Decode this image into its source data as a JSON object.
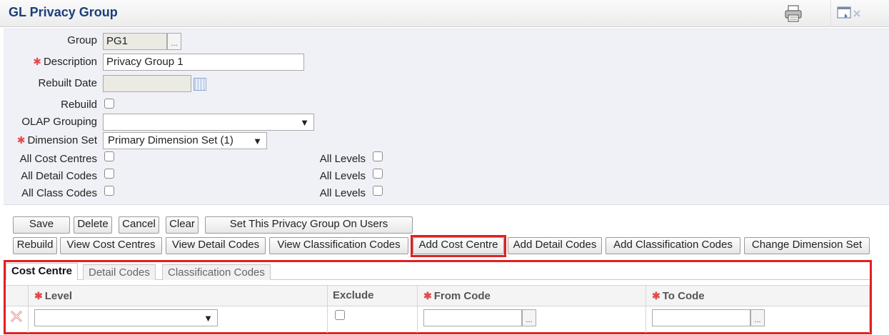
{
  "window": {
    "title": "GL Privacy Group"
  },
  "form": {
    "group_label": "Group",
    "group_value": "PG1",
    "lookup_glyph": "...",
    "description_label": "Description",
    "description_value": "Privacy Group 1",
    "rebuilt_date_label": "Rebuilt Date",
    "rebuild_label": "Rebuild",
    "olap_grouping_label": "OLAP Grouping",
    "dimension_set_label": "Dimension Set",
    "dimension_set_value": "Primary Dimension Set (1)",
    "all_cost_centres_label": "All Cost Centres",
    "all_detail_codes_label": "All Detail Codes",
    "all_class_codes_label": "All Class Codes",
    "all_levels_label": "All Levels",
    "required_marker": "✱"
  },
  "toolbar": {
    "save": "Save",
    "delete": "Delete",
    "cancel": "Cancel",
    "clear": "Clear",
    "set_on_users": "Set This Privacy Group On Users",
    "rebuild": "Rebuild",
    "view_cost_centres": "View Cost Centres",
    "view_detail_codes": "View Detail Codes",
    "view_classification_codes": "View Classification Codes",
    "add_cost_centre": "Add Cost Centre",
    "add_detail_codes": "Add Detail Codes",
    "add_classification_codes": "Add Classification Codes",
    "change_dimension_set": "Change Dimension Set"
  },
  "tabs": {
    "cost_centre": "Cost Centre",
    "detail_codes": "Detail Codes",
    "classification_codes": "Classification Codes"
  },
  "grid": {
    "columns": {
      "level": "Level",
      "exclude": "Exclude",
      "from_code": "From Code",
      "to_code": "To Code"
    }
  },
  "colors": {
    "title": "#1a3f7a",
    "highlight": "#e02020",
    "required": "#e24a4a",
    "panel": "#f0f0f7"
  },
  "icons": {
    "print": "printer-icon",
    "window": "window-close-icon",
    "delete_row": "delete-row-icon",
    "calendar": "calendar-icon"
  }
}
